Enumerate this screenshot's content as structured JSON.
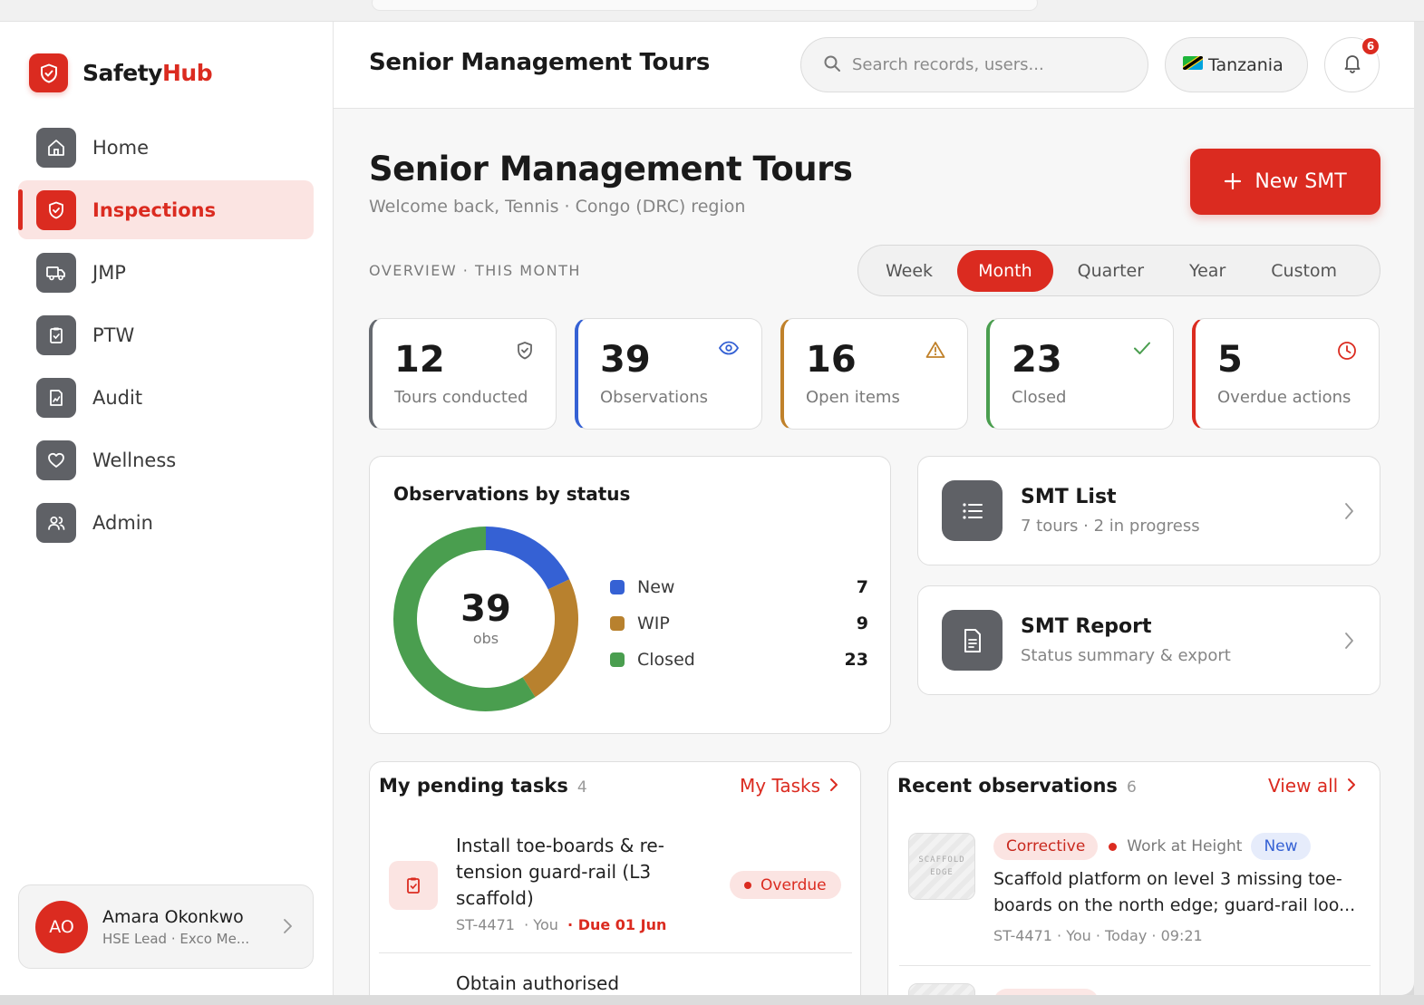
{
  "app": {
    "brand_prefix": "Safety",
    "brand_suffix": "Hub"
  },
  "sidebar": {
    "items": [
      {
        "label": "Home",
        "icon": "home-icon",
        "active": false
      },
      {
        "label": "Inspections",
        "icon": "shield-icon",
        "active": true
      },
      {
        "label": "JMP",
        "icon": "truck-icon",
        "active": false
      },
      {
        "label": "PTW",
        "icon": "clipboard-icon",
        "active": false
      },
      {
        "label": "Audit",
        "icon": "audit-icon",
        "active": false
      },
      {
        "label": "Wellness",
        "icon": "heart-icon",
        "active": false
      },
      {
        "label": "Admin",
        "icon": "users-icon",
        "active": false
      }
    ],
    "user": {
      "initials": "AO",
      "name": "Amara Okonkwo",
      "role": "HSE Lead · Exco Me..."
    }
  },
  "header": {
    "title": "Senior Management Tours",
    "search_placeholder": "Search records, users...",
    "country": "Tanzania",
    "notification_count": "6"
  },
  "page": {
    "title": "Senior Management Tours",
    "subtitle": "Welcome back, Tennis · Congo (DRC) region",
    "new_button": "New SMT",
    "overview_label": "OVERVIEW · THIS MONTH",
    "periods": [
      "Week",
      "Month",
      "Quarter",
      "Year",
      "Custom"
    ],
    "active_period": "Month"
  },
  "kpis": [
    {
      "value": "12",
      "label": "Tours conducted",
      "icon": "shield-check-icon",
      "color": "#666a70"
    },
    {
      "value": "39",
      "label": "Observations",
      "icon": "eye-icon",
      "color": "#3561d4"
    },
    {
      "value": "16",
      "label": "Open items",
      "icon": "warning-icon",
      "color": "#c0812a"
    },
    {
      "value": "23",
      "label": "Closed",
      "icon": "check-icon",
      "color": "#4a9e4f"
    },
    {
      "value": "5",
      "label": "Overdue actions",
      "icon": "clock-icon",
      "color": "#db2b20"
    }
  ],
  "donut": {
    "title": "Observations by status",
    "center_value": "39",
    "center_unit": "obs"
  },
  "chart_data": {
    "type": "pie",
    "title": "Observations by status",
    "categories": [
      "New",
      "WIP",
      "Closed"
    ],
    "values": [
      7,
      9,
      23
    ],
    "colors": [
      "#3561d4",
      "#b8812e",
      "#4a9e4f"
    ]
  },
  "links": [
    {
      "title": "SMT List",
      "subtitle": "7 tours · 2 in progress",
      "icon": "list-icon"
    },
    {
      "title": "SMT Report",
      "subtitle": "Status summary & export",
      "icon": "document-icon"
    }
  ],
  "tasks": {
    "title": "My pending tasks",
    "count": "4",
    "link": "My Tasks",
    "items": [
      {
        "title": "Install toe-boards & re-tension guard-rail (L3 scaffold)",
        "id": "ST-4471",
        "owner": "· You",
        "due": "· Due 01 Jun",
        "status": "Overdue"
      },
      {
        "title": "Obtain authorised"
      }
    ]
  },
  "observations": {
    "title": "Recent observations",
    "count": "6",
    "link": "View all",
    "items": [
      {
        "thumb_label": "SCAFFOLD EDGE",
        "type": "Corrective",
        "category": "Work at Height",
        "status": "New",
        "text": "Scaffold platform on level 3 missing toe-boards on the north edge; guard-rail loo...",
        "meta": "ST-4471 · You · Today · 09:21"
      }
    ]
  }
}
